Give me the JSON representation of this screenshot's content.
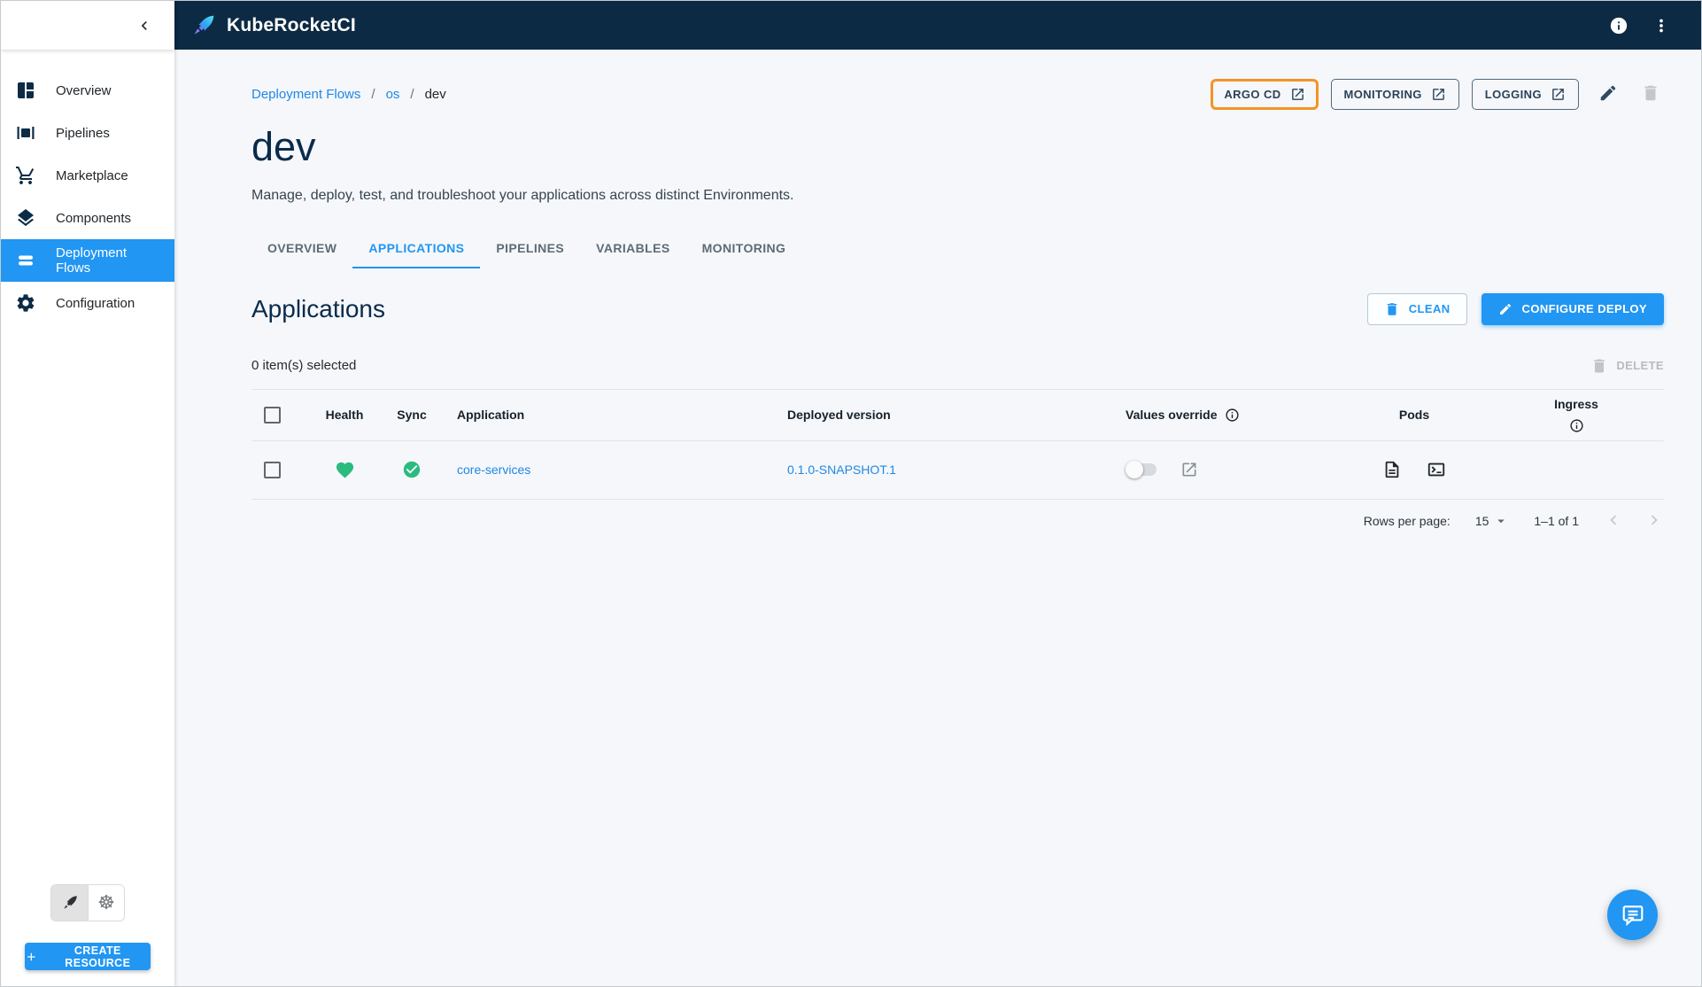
{
  "topbar": {
    "app_title": "KubeRocketCI"
  },
  "sidebar": {
    "items": [
      {
        "label": "Overview",
        "icon": "dashboard-icon",
        "selected": false
      },
      {
        "label": "Pipelines",
        "icon": "pipelines-icon",
        "selected": false
      },
      {
        "label": "Marketplace",
        "icon": "cart-icon",
        "selected": false
      },
      {
        "label": "Components",
        "icon": "layers-icon",
        "selected": false
      },
      {
        "label": "Deployment Flows",
        "icon": "flows-icon",
        "selected": true
      },
      {
        "label": "Configuration",
        "icon": "gear-icon",
        "selected": false
      }
    ],
    "create_button_label": "CREATE RESOURCE"
  },
  "breadcrumb": {
    "separator": "/",
    "items": [
      {
        "label": "Deployment Flows",
        "link": true
      },
      {
        "label": "os",
        "link": true
      },
      {
        "label": "dev",
        "link": false
      }
    ]
  },
  "header": {
    "title": "dev",
    "description": "Manage, deploy, test, and troubleshoot your applications across distinct Environments.",
    "links": [
      {
        "label": "ARGO CD",
        "highlighted": true
      },
      {
        "label": "MONITORING",
        "highlighted": false
      },
      {
        "label": "LOGGING",
        "highlighted": false
      }
    ]
  },
  "tabs": {
    "active": "APPLICATIONS",
    "items": [
      "OVERVIEW",
      "APPLICATIONS",
      "PIPELINES",
      "VARIABLES",
      "MONITORING"
    ]
  },
  "applications": {
    "heading": "Applications",
    "clean_label": "CLEAN",
    "configure_label": "CONFIGURE DEPLOY",
    "selected_text": "0 item(s) selected",
    "delete_label": "DELETE",
    "table": {
      "columns": [
        "Health",
        "Sync",
        "Application",
        "Deployed version",
        "Values override",
        "Pods",
        "Ingress"
      ],
      "rows": [
        {
          "health": "healthy",
          "sync": "synced",
          "application": "core-services",
          "deployed_version": "0.1.0-SNAPSHOT.1",
          "values_override_enabled": false
        }
      ]
    },
    "pagination": {
      "rows_per_page_label": "Rows per page:",
      "rows_per_page": "15",
      "range": "1–1 of 1"
    }
  },
  "icons": {
    "kubernetes_glyph": "☸"
  },
  "colors": {
    "accent": "#2196f3",
    "topbar_bg": "#0c2a43",
    "highlight_border": "#f39426",
    "success": "#2abb7f",
    "link": "#1e88e5",
    "content_bg": "#f5f7fa"
  }
}
